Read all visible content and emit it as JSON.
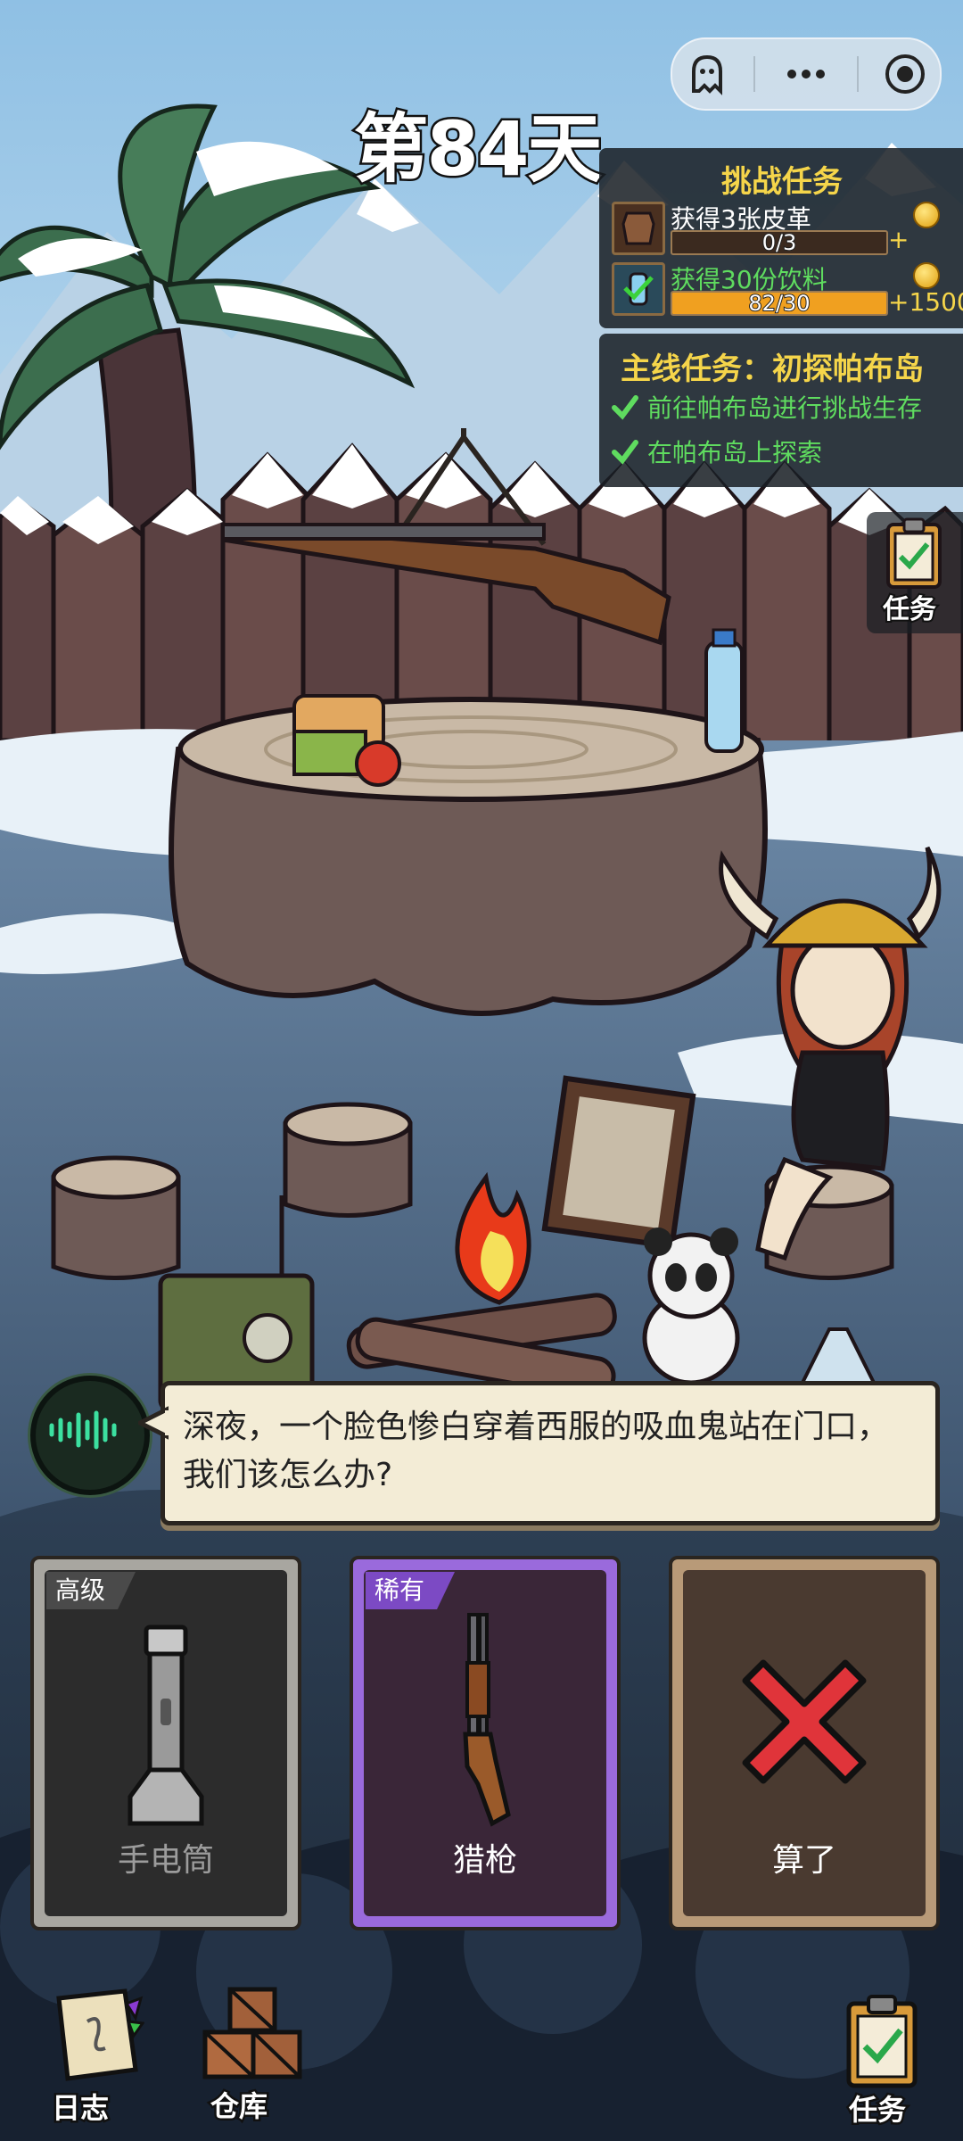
{
  "status": {
    "day_title": "第84天"
  },
  "capsule": {
    "icons": [
      "ghost-icon",
      "more-icon",
      "record-icon"
    ]
  },
  "challenge": {
    "title": "挑战任务",
    "tasks": [
      {
        "icon": "leather-icon",
        "text": "获得3张皮革",
        "progress_label": "0/3",
        "progress": 0.0,
        "reward": "+"
      },
      {
        "icon": "drink-icon",
        "text": "获得30份饮料",
        "progress_label": "82/30",
        "progress": 1.0,
        "reward": "+1500"
      }
    ]
  },
  "main_quest": {
    "title": "主线任务：初探帕布岛",
    "items": [
      {
        "text": "前往帕布岛进行挑战生存",
        "done": true
      },
      {
        "text": "在帕布岛上探索",
        "done": true
      }
    ]
  },
  "side_task_button": {
    "label": "任务"
  },
  "dialog": {
    "text": "深夜，一个脸色惨白穿着西服的吸血鬼站在门口，我们该怎么办?"
  },
  "choices": [
    {
      "tag": "高级",
      "name": "手电筒",
      "icon": "flashlight-icon"
    },
    {
      "tag": "稀有",
      "name": "猎枪",
      "icon": "shotgun-icon"
    },
    {
      "tag": "",
      "name": "算了",
      "icon": "cancel-x-icon"
    }
  ],
  "bottom_nav": {
    "journal": "日志",
    "warehouse": "仓库",
    "tasks": "任务"
  },
  "colors": {
    "quest_yellow": "#f5d54a",
    "done_green": "#5fdc5f",
    "progress_orange": "#f0a020",
    "rare_purple": "#9a6adc"
  }
}
